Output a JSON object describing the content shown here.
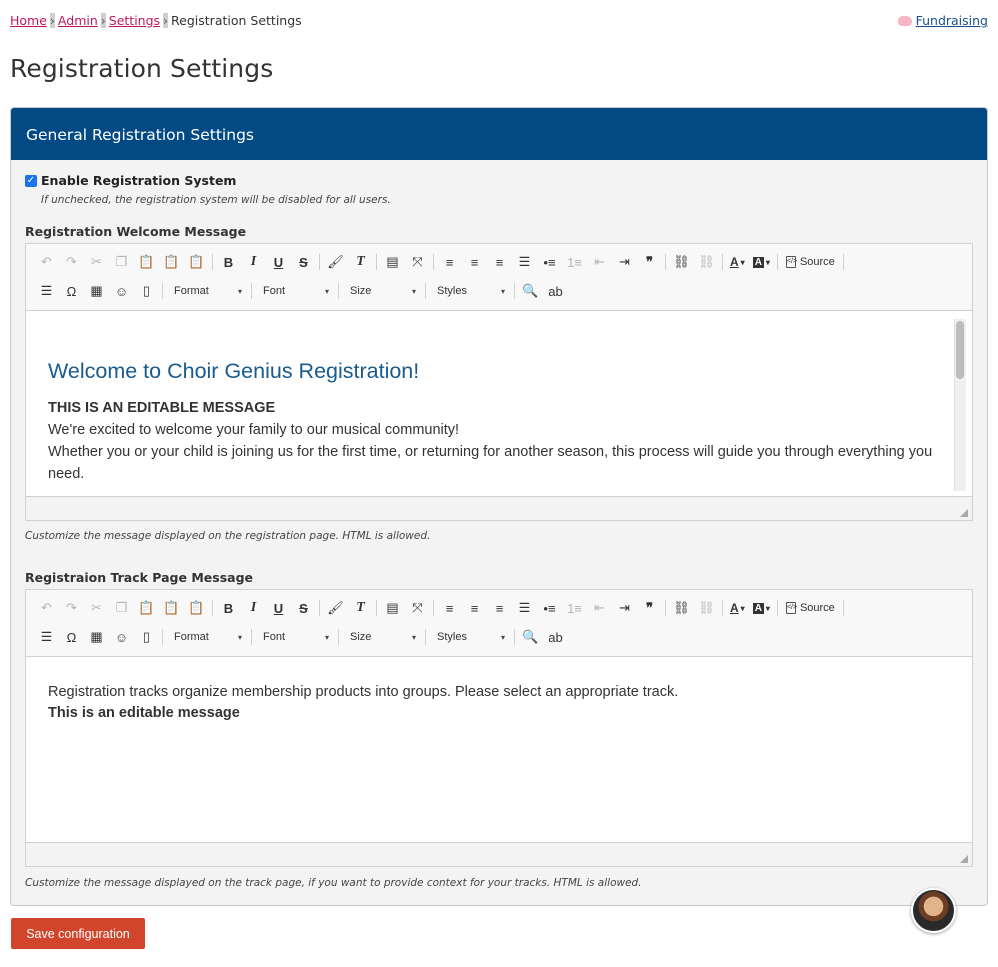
{
  "breadcrumb": {
    "items": [
      "Home",
      "Admin",
      "Settings"
    ],
    "current": "Registration Settings",
    "separator": "›"
  },
  "fundraising_link": "Fundraising",
  "page_title": "Registration Settings",
  "panel": {
    "header": "General Registration Settings",
    "enable_label": "Enable Registration System",
    "enable_checked": true,
    "enable_hint": "If unchecked, the registration system will be disabled for all users."
  },
  "toolbar": {
    "source_label": "Source",
    "format_label": "Format",
    "font_label": "Font",
    "size_label": "Size",
    "styles_label": "Styles"
  },
  "welcome_editor": {
    "label": "Registration Welcome Message",
    "heading": "Welcome to Choir Genius Registration!",
    "line1": "THIS IS AN EDITABLE MESSAGE",
    "line2": "We're excited to welcome your family to our musical community!",
    "line3": "Whether you or your child is joining us for the first time, or returning for another season, this process will guide you through everything you need.",
    "help": "Customize the message displayed on the registration page. HTML is allowed."
  },
  "track_editor": {
    "label": "Registraion Track Page Message",
    "line1": "Registration tracks organize membership products into groups. Please select an appropriate track.",
    "line2": "This is an editable message",
    "help": "Customize the message displayed on the track page, if you want to provide context for your tracks. HTML is allowed."
  },
  "save_button": "Save configuration",
  "colors": {
    "panel_header": "#034a84",
    "link": "#c2185b",
    "save_button": "#d2452d",
    "heading_blue": "#1a5b8e"
  }
}
